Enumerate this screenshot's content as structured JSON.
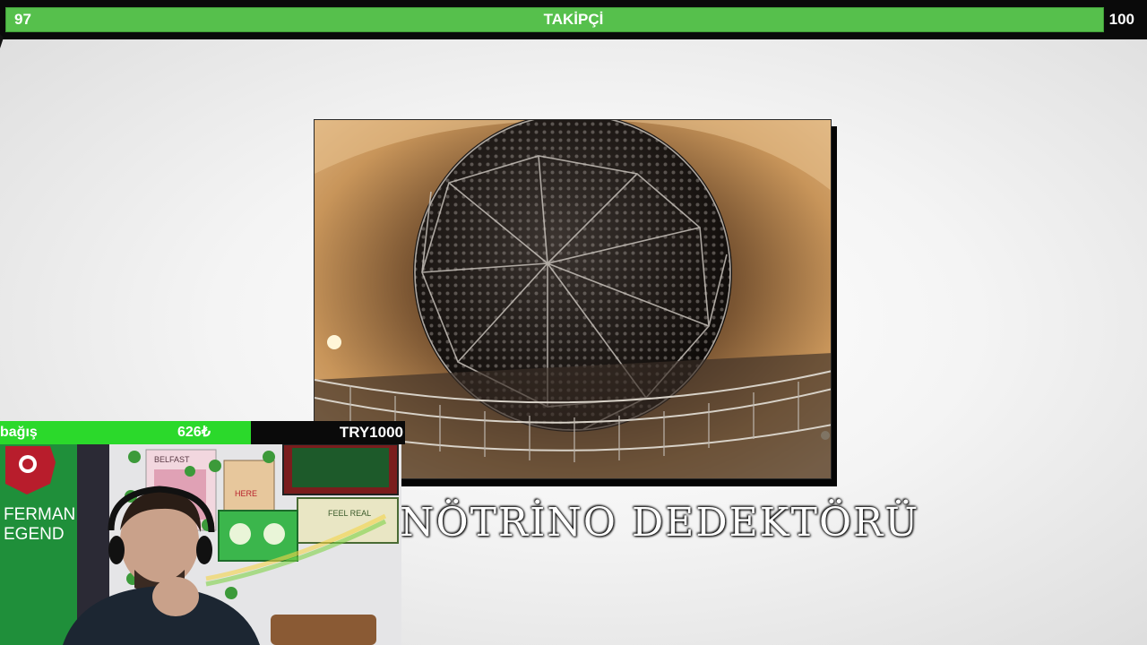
{
  "follower_goal": {
    "current": "97",
    "title": "TAKİPÇİ",
    "target": "100",
    "progress_fraction": 0.97,
    "fill_color": "#56c04c"
  },
  "media": {
    "caption": "NÖTRİNO DEDEKTÖRÜ",
    "photo_icon": "neutrino-detector-sphere"
  },
  "donation_goal": {
    "label": "bağış",
    "amount": "626₺",
    "goal": "TRY1000",
    "progress_fraction": 0.626,
    "fill_color": "#2bd92b"
  },
  "webcam": {
    "banner_text_1": "FERMAN",
    "banner_text_2": "EGEND",
    "poster_text_1": "BELFAST",
    "poster_text_2": "HERE",
    "poster_text_3": "FEEL REAL"
  }
}
